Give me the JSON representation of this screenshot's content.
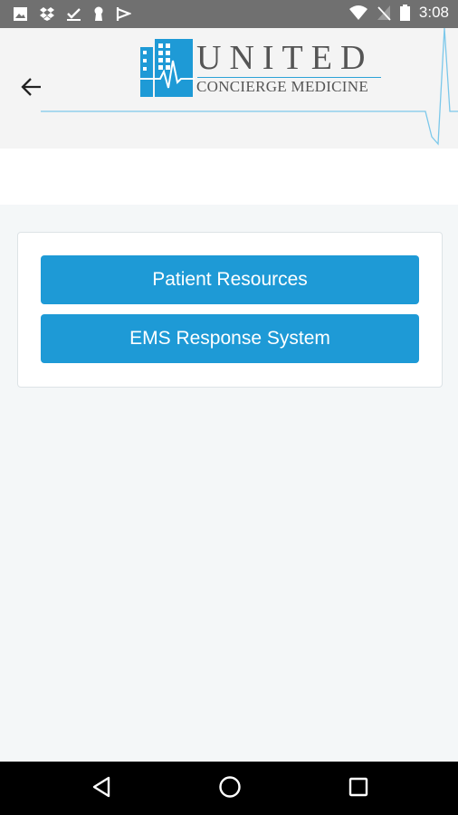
{
  "status_bar": {
    "time": "3:08",
    "left_icons": [
      "image-icon",
      "dropbox-icon",
      "check-icon",
      "keyhole-icon",
      "flag-icon"
    ],
    "right_icons": [
      "wifi-icon",
      "no-signal-icon",
      "battery-icon"
    ]
  },
  "header": {
    "back_icon": "arrow-left-icon",
    "logo": {
      "word": "UNITED",
      "sub": "CONCIERGE MEDICINE"
    }
  },
  "menu": {
    "buttons": [
      {
        "label": "Patient Resources"
      },
      {
        "label": "EMS Response System"
      }
    ]
  },
  "navigation": {
    "icons": [
      "back-triangle-icon",
      "home-circle-icon",
      "recents-square-icon"
    ]
  },
  "colors": {
    "accent": "#1e9ad6",
    "status_bar": "#707070",
    "background": "#f4f7f8"
  }
}
